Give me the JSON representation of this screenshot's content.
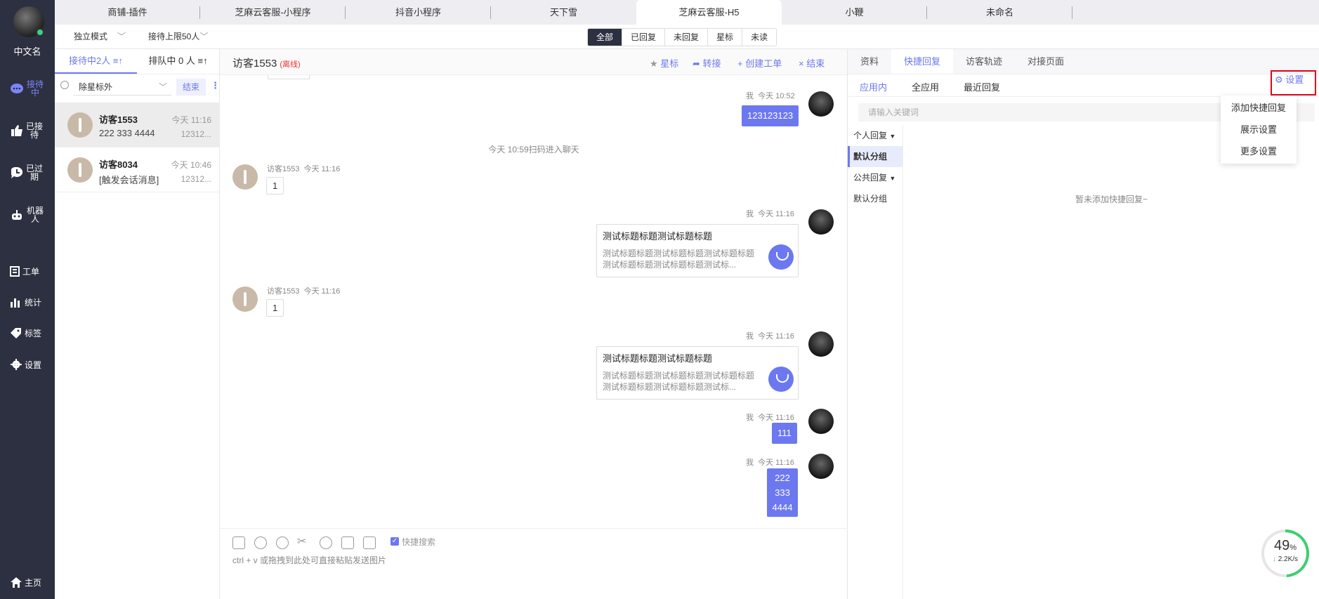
{
  "nav": {
    "user_name": "中文名",
    "items": [
      {
        "label": "接待中",
        "icon": "chat-bubble-icon",
        "active": true
      },
      {
        "label": "已接待",
        "icon": "thumbs-up-icon"
      },
      {
        "label": "已过期",
        "icon": "clock-bubble-icon"
      },
      {
        "label": "机器人",
        "icon": "robot-icon"
      },
      {
        "label": "工单",
        "icon": "ticket-icon"
      },
      {
        "label": "统计",
        "icon": "bar-chart-icon"
      },
      {
        "label": "标签",
        "icon": "tag-icon"
      },
      {
        "label": "设置",
        "icon": "gear-icon"
      }
    ],
    "home_label": "主页"
  },
  "tabs": [
    "商铺-插件",
    "芝麻云客服-小程序",
    "抖音小程序",
    "天下雪",
    "芝麻云客服-H5",
    "小鞭",
    "未命名"
  ],
  "active_tab": 4,
  "toolbar": {
    "mode": "独立模式",
    "limit": "接待上限50人",
    "filters": [
      "全部",
      "已回复",
      "未回复",
      "星标",
      "未读"
    ],
    "active_filter": 0
  },
  "list": {
    "tab_serving": "接待中2人",
    "tab_queue": "排队中 0 人",
    "filter_value": "除星标外",
    "end_label": "结束",
    "rows": [
      {
        "name": "访客1553",
        "msg": "222 333 4444",
        "time": "今天 11:16",
        "id": "12312..."
      },
      {
        "name": "访客8034",
        "msg": "[触发会话消息]",
        "time": "今天 10:46",
        "id": "12312..."
      }
    ]
  },
  "chat": {
    "title": "访客1553",
    "status": "(离线)",
    "actions": {
      "star": "星标",
      "transfer": "转接",
      "ticket": "创建工单",
      "end": "结束"
    },
    "me": "我",
    "visitor": "访客1553",
    "t1052": "今天 10:52",
    "t1116": "今天 11:16",
    "system": "今天 10:59扫码进入聊天",
    "msg1": "123123123",
    "visitor_msg": "1",
    "card_title": "测试标题标题测试标题标题",
    "card_desc": "测试标题标题测试标题标题测试标题标题测试标题标题测试标题标题测试标...",
    "msg111": "111",
    "multi": [
      "222",
      "333",
      "4444"
    ],
    "quick_search": "快捷搜索",
    "hint": "ctrl + v 或拖拽到此处可直接粘贴发送图片"
  },
  "right": {
    "tabs": [
      "资料",
      "快捷回复",
      "访客轨迹",
      "对接页面"
    ],
    "active_tab": 1,
    "sub": [
      "应用内",
      "全应用",
      "最近回复"
    ],
    "settings": "设置",
    "search_placeholder": "请输入关键词",
    "groups": [
      "个人回复",
      "默认分组",
      "公共回复",
      "默认分组"
    ],
    "empty": "暂未添加快捷回复~",
    "menu": [
      "添加快捷回复",
      "展示设置",
      "更多设置"
    ]
  },
  "net": {
    "percent": "49",
    "unit": "%",
    "speed": "2.2K/s",
    "progress": 0.49
  }
}
